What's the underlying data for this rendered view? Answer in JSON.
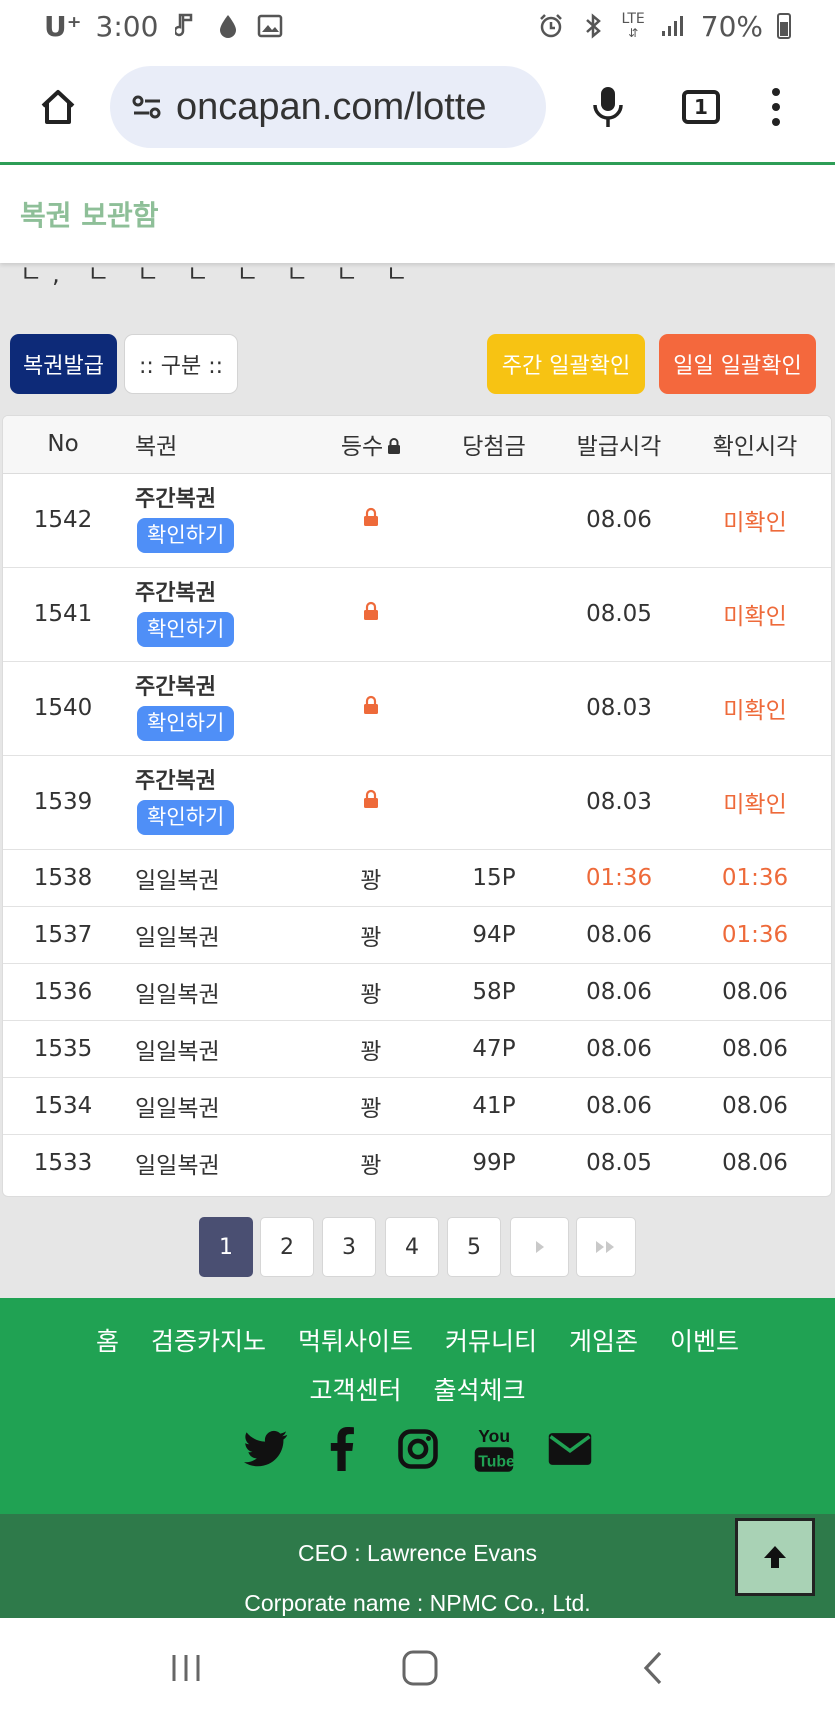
{
  "status_bar": {
    "carrier": "U⁺",
    "time": "3:00",
    "network": "LTE",
    "battery": "70%"
  },
  "browser": {
    "url": "oncapan.com/lotte",
    "tab_count": "1"
  },
  "page": {
    "sticky_title": "복권 보관함",
    "clipped_text": "ㄴ, ㄴ ㄴ ㄴ ㄴ ㄴ ㄴ ㄴ"
  },
  "filters": {
    "issue_label": "복권발급",
    "category_label": ":: 구분 ::",
    "weekly_check_label": "주간 일괄확인",
    "daily_check_label": "일일 일괄확인"
  },
  "table": {
    "headers": {
      "no": "No",
      "name": "복권",
      "rank": "등수",
      "prize": "당첨금",
      "issued": "발급시각",
      "checked": "확인시각"
    },
    "confirm_label": "확인하기",
    "weekly_rows": [
      {
        "no": "1542",
        "name": "주간복권",
        "issued": "08.06",
        "checked": "미확인"
      },
      {
        "no": "1541",
        "name": "주간복권",
        "issued": "08.05",
        "checked": "미확인"
      },
      {
        "no": "1540",
        "name": "주간복권",
        "issued": "08.03",
        "checked": "미확인"
      },
      {
        "no": "1539",
        "name": "주간복권",
        "issued": "08.03",
        "checked": "미확인"
      }
    ],
    "daily_rows": [
      {
        "no": "1538",
        "name": "일일복권",
        "rank": "꽝",
        "prize": "15P",
        "issued": "01:36",
        "checked": "01:36"
      },
      {
        "no": "1537",
        "name": "일일복권",
        "rank": "꽝",
        "prize": "94P",
        "issued": "08.06",
        "checked": "01:36"
      },
      {
        "no": "1536",
        "name": "일일복권",
        "rank": "꽝",
        "prize": "58P",
        "issued": "08.06",
        "checked": "08.06"
      },
      {
        "no": "1535",
        "name": "일일복권",
        "rank": "꽝",
        "prize": "47P",
        "issued": "08.06",
        "checked": "08.06"
      },
      {
        "no": "1534",
        "name": "일일복권",
        "rank": "꽝",
        "prize": "41P",
        "issued": "08.06",
        "checked": "08.06"
      },
      {
        "no": "1533",
        "name": "일일복권",
        "rank": "꽝",
        "prize": "99P",
        "issued": "08.05",
        "checked": "08.06"
      }
    ]
  },
  "pagination": {
    "pages": [
      "1",
      "2",
      "3",
      "4",
      "5"
    ],
    "current": "1"
  },
  "footer": {
    "nav_row1": [
      "홈",
      "검증카지노",
      "먹튀사이트",
      "커뮤니티",
      "게임존",
      "이벤트"
    ],
    "nav_row2": [
      "고객센터",
      "출석체크"
    ],
    "social_icons": [
      "twitter-icon",
      "facebook-icon",
      "instagram-icon",
      "youtube-icon",
      "mail-icon"
    ],
    "ceo": "CEO : Lawrence Evans",
    "corp": "Corporate name : NPMC Co., Ltd."
  },
  "colors": {
    "green": "#20a253",
    "dark_green": "#2e7a4a",
    "navy": "#0d2a78",
    "yellow": "#f7c313",
    "orange": "#f4683d",
    "link_blue": "#4f8ff7"
  }
}
